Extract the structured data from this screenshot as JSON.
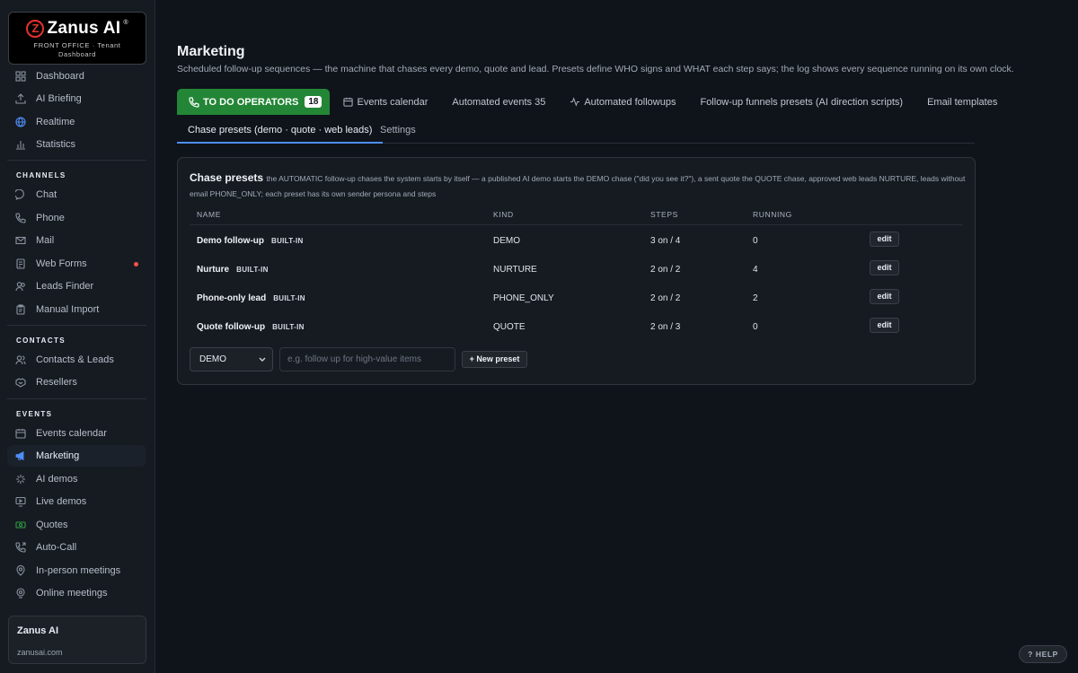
{
  "brand": {
    "logo_mark": "Z",
    "logo_text": "Zanus AI",
    "logo_reg": "®",
    "logo_sub1": "FRONT OFFICE · Tenant",
    "logo_sub2": "Dashboard"
  },
  "sidebar": {
    "top_items": [
      {
        "label": "Dashboard",
        "icon": "grid-icon"
      },
      {
        "label": "AI Briefing",
        "icon": "upload-icon"
      },
      {
        "label": "Realtime",
        "icon": "globe-icon"
      },
      {
        "label": "Statistics",
        "icon": "bar-chart-icon"
      }
    ],
    "channels_heading": "CHANNELS",
    "channels": [
      {
        "label": "Chat",
        "icon": "chat-bubble-icon"
      },
      {
        "label": "Phone",
        "icon": "phone-icon"
      },
      {
        "label": "Mail",
        "icon": "mail-icon"
      },
      {
        "label": "Web Forms",
        "icon": "form-icon",
        "alert_dot": true
      },
      {
        "label": "Leads Finder",
        "icon": "users-search-icon"
      },
      {
        "label": "Manual Import",
        "icon": "clipboard-icon"
      }
    ],
    "contacts_heading": "CONTACTS",
    "contacts": [
      {
        "label": "Contacts & Leads",
        "icon": "contacts-icon"
      },
      {
        "label": "Resellers",
        "icon": "handshake-icon"
      }
    ],
    "events_heading": "EVENTS",
    "events": [
      {
        "label": "Events calendar",
        "icon": "calendar-icon"
      },
      {
        "label": "Marketing",
        "icon": "megaphone-icon",
        "active": true
      },
      {
        "label": "AI demos",
        "icon": "sparkle-icon"
      },
      {
        "label": "Live demos",
        "icon": "monitor-play-icon"
      },
      {
        "label": "Quotes",
        "icon": "money-icon"
      },
      {
        "label": "Auto-Call",
        "icon": "phone-forward-icon"
      },
      {
        "label": "In-person meetings",
        "icon": "map-pin-icon"
      },
      {
        "label": "Online meetings",
        "icon": "video-pin-icon"
      }
    ],
    "tenant_name": "Zanus AI",
    "tenant_url": "zanusai.com"
  },
  "page": {
    "title": "Marketing",
    "description": "Scheduled follow-up sequences — the machine that chases every demo, quote and lead. Presets define WHO signs and WHAT each step says; the log shows every sequence running on its own clock."
  },
  "tabs": {
    "todo_label": "TO DO OPERATORS",
    "todo_count": "18",
    "events_calendar": "Events calendar",
    "automated_events": "Automated events 35",
    "automated_followups": "Automated followups",
    "funnels": "Follow-up funnels presets (AI direction scripts)",
    "email_templates": "Email templates"
  },
  "subtabs": {
    "chase_presets": "Chase presets (demo · quote · web leads)",
    "settings": "Settings"
  },
  "card": {
    "title": "Chase presets",
    "description": "the AUTOMATIC follow-up chases the system starts by itself — a published AI demo starts the DEMO chase (\"did you see it?\"), a sent quote the QUOTE chase, approved web leads NURTURE, leads without email PHONE_ONLY; each preset has its own sender persona and steps"
  },
  "table": {
    "headers": {
      "name": "NAME",
      "kind": "KIND",
      "steps": "STEPS",
      "running": "RUNNING"
    },
    "rows": [
      {
        "name": "Demo follow-up",
        "tag": "BUILT-IN",
        "kind": "DEMO",
        "steps": "3 on / 4",
        "running": "0",
        "action": "edit"
      },
      {
        "name": "Nurture",
        "tag": "BUILT-IN",
        "kind": "NURTURE",
        "steps": "2 on / 2",
        "running": "4",
        "action": "edit"
      },
      {
        "name": "Phone-only lead",
        "tag": "BUILT-IN",
        "kind": "PHONE_ONLY",
        "steps": "2 on / 2",
        "running": "2",
        "action": "edit"
      },
      {
        "name": "Quote follow-up",
        "tag": "BUILT-IN",
        "kind": "QUOTE",
        "steps": "2 on / 3",
        "running": "0",
        "action": "edit"
      }
    ]
  },
  "new_preset_form": {
    "kind_selected": "DEMO",
    "name_placeholder": "e.g. follow up for high-value items",
    "button_label": "+ New preset"
  },
  "help_label": "? HELP",
  "colors": {
    "accent_green": "#238636",
    "accent_blue": "#4f8ef7",
    "alert_red": "#f85149",
    "brand_red": "#e5322d"
  }
}
